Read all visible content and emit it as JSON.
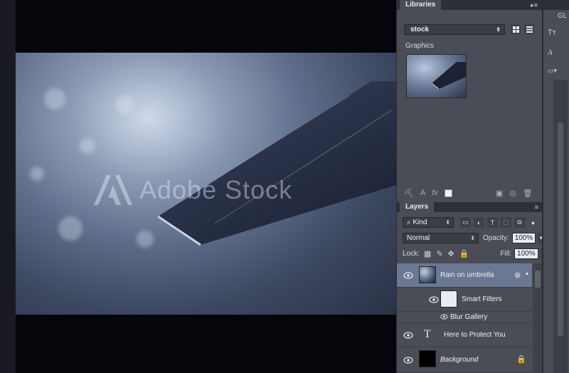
{
  "canvas": {
    "watermark": "Adobe Stock"
  },
  "libraries": {
    "tab_label": "Libraries",
    "library_select": "stock",
    "section_label": "Graphics"
  },
  "layers": {
    "tab_label": "Layers",
    "filter_kind": "Kind",
    "blend_mode": "Normal",
    "opacity_label": "Opacity:",
    "opacity_value": "100%",
    "lock_label": "Lock:",
    "fill_label": "Fill:",
    "fill_value": "100%",
    "items": [
      {
        "name": "Rain on umbrella",
        "type": "smart-object",
        "selected": true
      },
      {
        "name": "Smart Filters",
        "type": "smart-filters"
      },
      {
        "name": "Blur Gallery",
        "type": "filter"
      },
      {
        "name": "Here to Protect You",
        "type": "text"
      },
      {
        "name": "Background",
        "type": "background",
        "locked": true
      }
    ]
  },
  "right_strip": {
    "glyph_tt": "Tт",
    "glyph_gl": "GL"
  },
  "colors": {
    "panel_bg": "#4a4d55",
    "selected_row": "#6b7893",
    "tab_bar": "#2e3036"
  }
}
